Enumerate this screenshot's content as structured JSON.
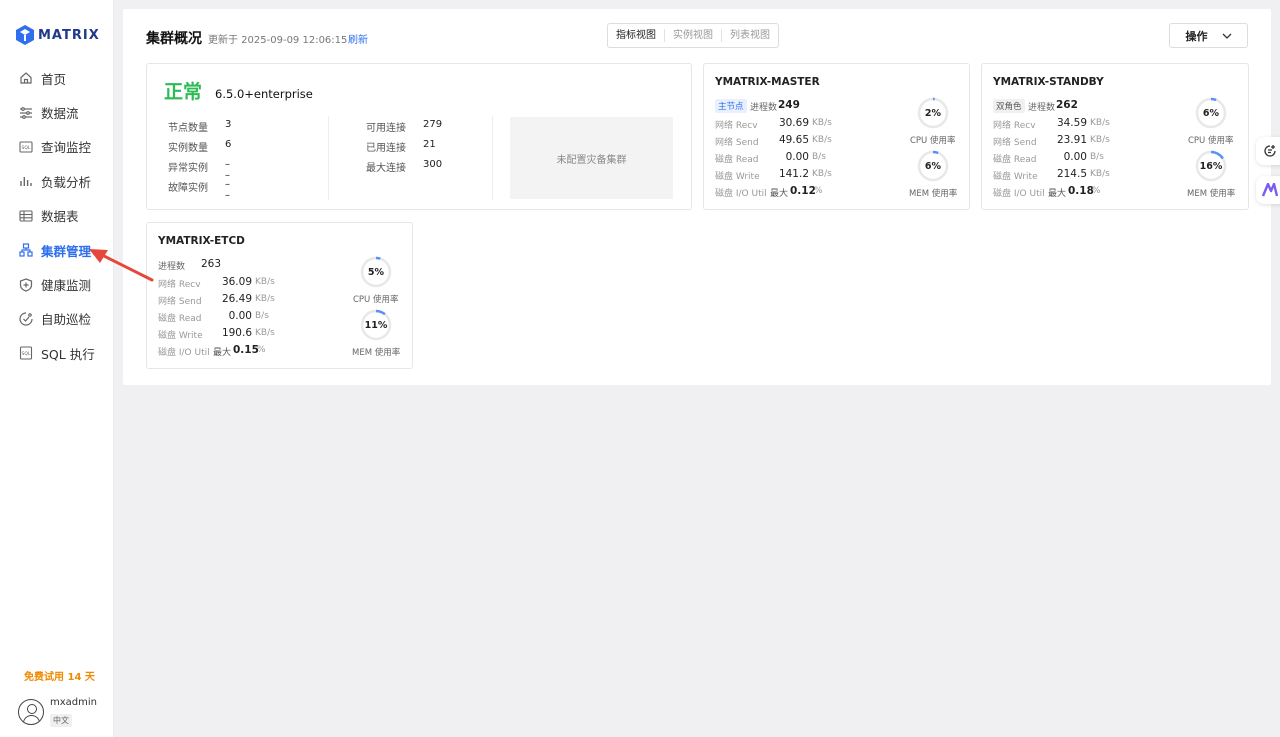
{
  "brand": {
    "name": "MATRIX",
    "color": "#2f6fed"
  },
  "sidebar": {
    "items": [
      {
        "label": "首页",
        "icon": "home-icon"
      },
      {
        "label": "数据流",
        "icon": "dataflow-icon"
      },
      {
        "label": "查询监控",
        "icon": "sql-monitor-icon"
      },
      {
        "label": "负载分析",
        "icon": "bar-chart-icon"
      },
      {
        "label": "数据表",
        "icon": "table-icon"
      },
      {
        "label": "集群管理",
        "icon": "cluster-icon",
        "active": true
      },
      {
        "label": "健康监测",
        "icon": "shield-icon"
      },
      {
        "label": "自助巡检",
        "icon": "inspection-icon"
      },
      {
        "label": "SQL 执行",
        "icon": "sql-exec-icon"
      }
    ],
    "trial": "免费试用 14 天",
    "user": {
      "name": "mxadmin",
      "lang": "中文"
    }
  },
  "header": {
    "title": "集群概况",
    "updated": "更新于 2025-09-09 12:06:15",
    "refresh": "刷新",
    "tabs": [
      "指标视图",
      "实例视图",
      "列表视图"
    ],
    "ops": "操作"
  },
  "overview": {
    "status": "正常",
    "status_color": "#2dbb55",
    "version": "6.5.0+enterprise",
    "left": [
      {
        "label": "节点数量",
        "value": "3"
      },
      {
        "label": "实例数量",
        "value": "6"
      },
      {
        "label": "异常实例",
        "value": "– –"
      },
      {
        "label": "故障实例",
        "value": "– –"
      }
    ],
    "right": [
      {
        "label": "可用连接",
        "value": "279"
      },
      {
        "label": "已用连接",
        "value": "21"
      },
      {
        "label": "最大连接",
        "value": "300"
      }
    ],
    "dr": "未配置灾备集群"
  },
  "nodes": {
    "master": {
      "name": "YMATRIX-MASTER",
      "role": "主节点",
      "proc_label": "进程数",
      "proc": "249",
      "recv_label": "网络 Recv",
      "recv": "30.69",
      "recv_unit": "KB/s",
      "send_label": "网络 Send",
      "send": "49.65",
      "send_unit": "KB/s",
      "read_label": "磁盘 Read",
      "read": "0.00",
      "read_unit": "B/s",
      "write_label": "磁盘 Write",
      "write": "141.2",
      "write_unit": "KB/s",
      "io_label": "磁盘 I/O Util",
      "io_max": "最大",
      "io": "0.12",
      "io_unit": "%",
      "cpu": "2%",
      "cpu_pct": 2,
      "cpu_label": "CPU 使用率",
      "mem": "6%",
      "mem_pct": 6,
      "mem_label": "MEM 使用率"
    },
    "standby": {
      "name": "YMATRIX-STANDBY",
      "role": "双角色",
      "proc_label": "进程数",
      "proc": "262",
      "recv_label": "网络 Recv",
      "recv": "34.59",
      "recv_unit": "KB/s",
      "send_label": "网络 Send",
      "send": "23.91",
      "send_unit": "KB/s",
      "read_label": "磁盘 Read",
      "read": "0.00",
      "read_unit": "B/s",
      "write_label": "磁盘 Write",
      "write": "214.5",
      "write_unit": "KB/s",
      "io_label": "磁盘 I/O Util",
      "io_max": "最大",
      "io": "0.18",
      "io_unit": "%",
      "cpu": "6%",
      "cpu_pct": 6,
      "cpu_label": "CPU 使用率",
      "mem": "16%",
      "mem_pct": 16,
      "mem_label": "MEM 使用率"
    },
    "etcd": {
      "name": "YMATRIX-ETCD",
      "proc_label": "进程数",
      "proc": "263",
      "recv_label": "网络 Recv",
      "recv": "36.09",
      "recv_unit": "KB/s",
      "send_label": "网络 Send",
      "send": "26.49",
      "send_unit": "KB/s",
      "read_label": "磁盘 Read",
      "read": "0.00",
      "read_unit": "B/s",
      "write_label": "磁盘 Write",
      "write": "190.6",
      "write_unit": "KB/s",
      "io_label": "磁盘 I/O Util",
      "io_max": "最大",
      "io": "0.15",
      "io_unit": "%",
      "cpu": "5%",
      "cpu_pct": 5,
      "cpu_label": "CPU 使用率",
      "mem": "11%",
      "mem_pct": 11,
      "mem_label": "MEM 使用率"
    }
  },
  "gauge_color": "#5b8ff9",
  "gauge_track": "#e8e8e8",
  "annotation_color": "#e5483b"
}
